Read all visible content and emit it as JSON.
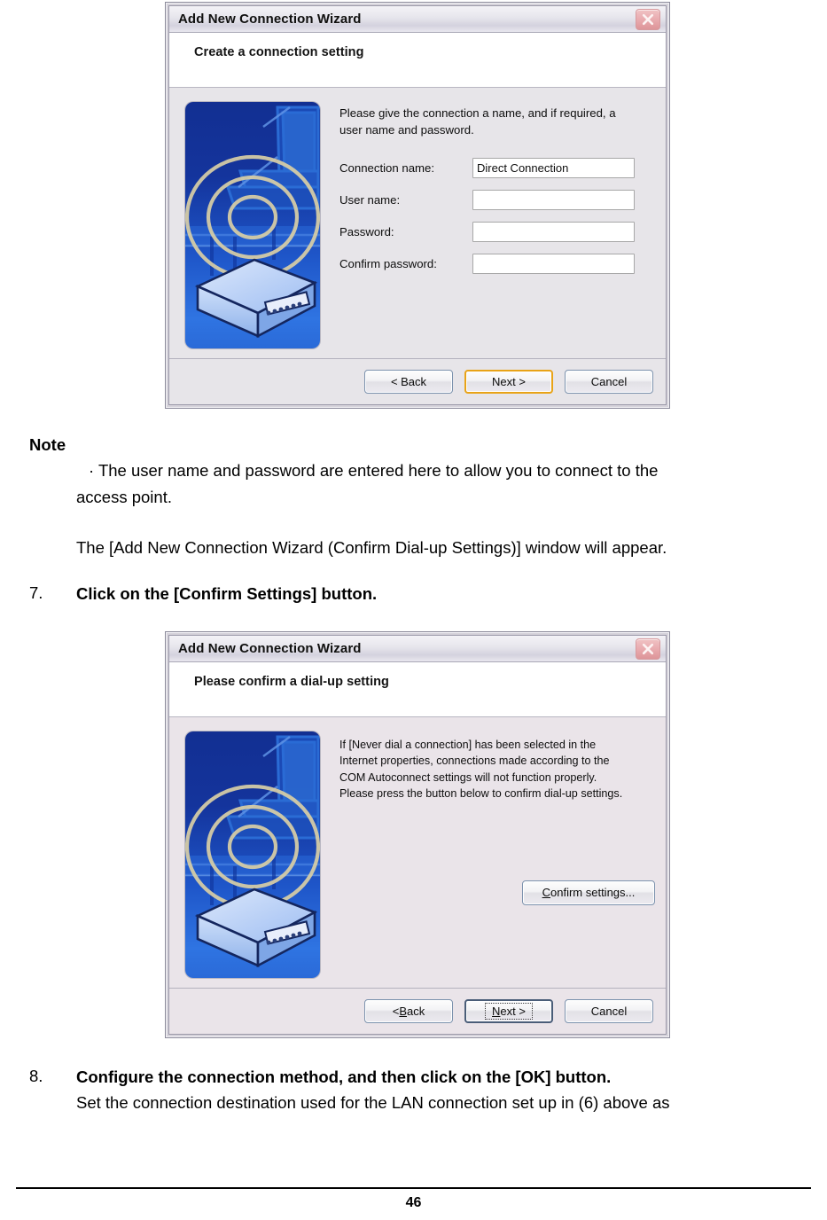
{
  "document": {
    "page_number": "46",
    "note_heading": "Note",
    "note_bullet_line1": "· The user name and password are entered here to allow you to connect to the",
    "note_bullet_line2": "access point.",
    "result_sentence": "The [Add New Connection Wizard (Confirm Dial-up Settings)] window will appear.",
    "step7_number": "7.",
    "step7_text": "Click on the [Confirm Settings] button.",
    "step8_number": "8.",
    "step8_text": "Configure the connection method, and then click on the [OK] button.",
    "step8_detail": "Set the connection destination used for the LAN connection set up in (6) above as"
  },
  "dialog1": {
    "title": "Add New Connection Wizard",
    "close_icon": "close-icon",
    "header": "Create a connection setting",
    "intro": "Please give the connection a name, and if required, a user name and password.",
    "fields": [
      {
        "label": "Connection name:",
        "value": "Direct Connection"
      },
      {
        "label": "User name:",
        "value": ""
      },
      {
        "label": "Password:",
        "value": ""
      },
      {
        "label": "Confirm password:",
        "value": ""
      }
    ],
    "buttons": {
      "back": "< Back",
      "next": "Next >",
      "cancel": "Cancel"
    }
  },
  "dialog2": {
    "title": "Add New Connection Wizard",
    "close_icon": "close-icon",
    "header": "Please confirm a dial-up setting",
    "message_lines": [
      "If [Never dial a connection] has been selected in the",
      "Internet properties, connections made according to the",
      "COM Autoconnect settings will not function properly.",
      "Please press the button below to confirm dial-up settings."
    ],
    "confirm_button": {
      "mnemonic": "C",
      "rest": "onfirm settings..."
    },
    "buttons": {
      "back_mnemonic": "B",
      "back_prefix": "< ",
      "back_rest": "ack",
      "next_mnemonic": "N",
      "next_rest": "ext >",
      "cancel": "Cancel"
    }
  },
  "colors": {
    "accent_orange": "#e8a317",
    "dialog_face": "#e7e5e9",
    "illustration_blue": "#14349c",
    "ring_tan": "#d9cfa6"
  }
}
